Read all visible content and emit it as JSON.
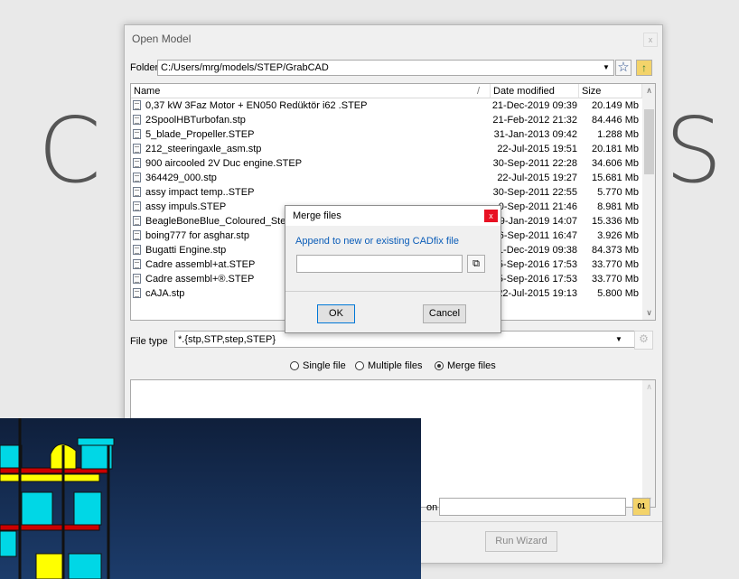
{
  "background": {
    "left_text": "C",
    "right_text": "S"
  },
  "open_model": {
    "title": "Open Model",
    "close_glyph": "x",
    "folder_label": "Folder",
    "folder_value": "C:/Users/mrg/models/STEP/GrabCAD",
    "columns": {
      "name": "Name",
      "sort_glyph": "/",
      "date": "Date modified",
      "size": "Size"
    },
    "files": [
      {
        "name": "0,37 kW 3Faz Motor + EN050 Redüktör i62 .STEP",
        "date": "21-Dec-2019 09:39",
        "size": "20.149 Mb"
      },
      {
        "name": "2SpoolHBTurbofan.stp",
        "date": "21-Feb-2012 21:32",
        "size": "84.446 Mb"
      },
      {
        "name": "5_blade_Propeller.STEP",
        "date": "31-Jan-2013 09:42",
        "size": "1.288 Mb"
      },
      {
        "name": "212_steeringaxle_asm.stp",
        "date": "22-Jul-2015 19:51",
        "size": "20.181 Mb"
      },
      {
        "name": "900 aircooled 2V Duc engine.STEP",
        "date": "30-Sep-2011 22:28",
        "size": "34.606 Mb"
      },
      {
        "name": "364429_000.stp",
        "date": "22-Jul-2015 19:27",
        "size": "15.681 Mb"
      },
      {
        "name": "assy impact temp..STEP",
        "date": "30-Sep-2011 22:55",
        "size": "5.770 Mb"
      },
      {
        "name": "assy impuls.STEP",
        "date": "0-Sep-2011 21:46",
        "size": "8.981 Mb"
      },
      {
        "name": "BeagleBoneBlue_Coloured_Step.s",
        "date": "29-Jan-2019 14:07",
        "size": "15.336 Mb"
      },
      {
        "name": "boing777 for asghar.stp",
        "date": "6-Sep-2011 16:47",
        "size": "3.926 Mb"
      },
      {
        "name": "Bugatti Engine.stp",
        "date": "1-Dec-2019 09:38",
        "size": "84.373 Mb"
      },
      {
        "name": "Cadre assembl+at.STEP",
        "date": "5-Sep-2016 17:53",
        "size": "33.770 Mb"
      },
      {
        "name": "Cadre assembl+®.STEP",
        "date": "5-Sep-2016 17:53",
        "size": "33.770 Mb"
      },
      {
        "name": "cAJA.stp",
        "date": "22-Jul-2015 19:13",
        "size": "5.800 Mb"
      }
    ],
    "filetype_label": "File type",
    "filetype_value": "*.{stp,STP,step,STEP}",
    "radios": [
      {
        "label": "Single file",
        "checked": false
      },
      {
        "label": "Multiple files",
        "checked": false
      },
      {
        "label": "Merge files",
        "checked": true
      }
    ],
    "partial_label": "on",
    "run_wizard": "Run Wizard",
    "browse_glyph": "01"
  },
  "merge_dialog": {
    "title": "Merge files",
    "close_glyph": "x",
    "prompt": "Append to new or existing CADfix file",
    "input_value": "",
    "ok": "OK",
    "cancel": "Cancel"
  },
  "colors": {
    "link_blue": "#0b5db8",
    "close_red": "#e81123",
    "viewport_blue": "#14294d",
    "model_cyan": "#00d7e6",
    "model_yellow": "#ffff00",
    "frame_red": "#cc0000"
  }
}
